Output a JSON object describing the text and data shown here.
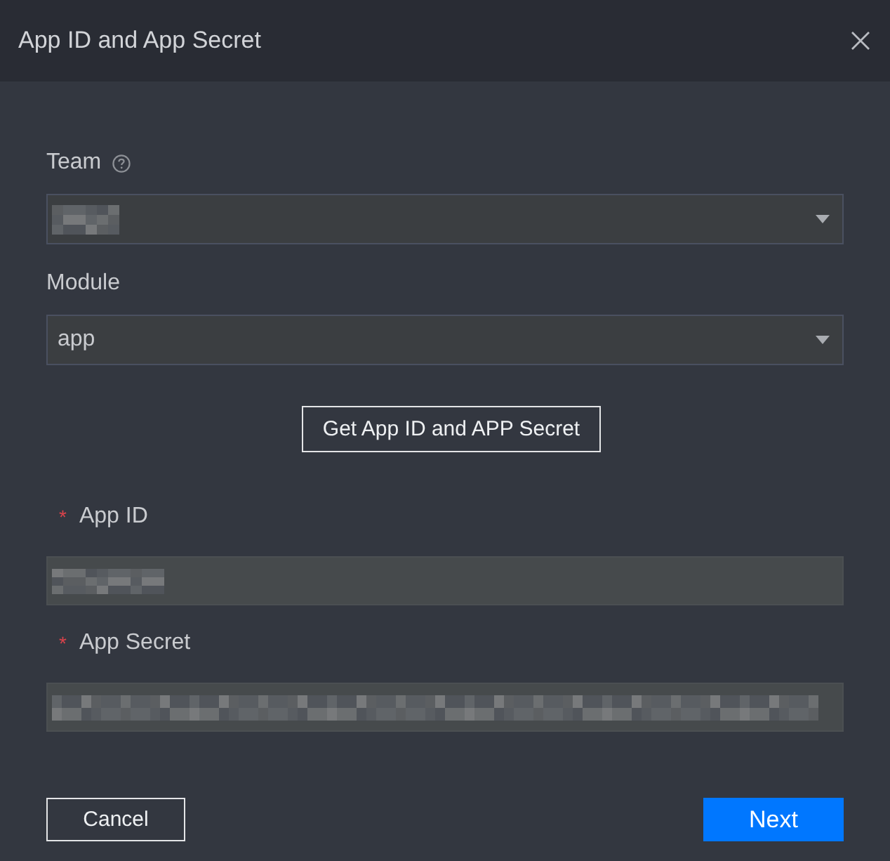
{
  "dialog": {
    "title": "App ID and App Secret"
  },
  "form": {
    "fields": [
      {
        "kind": "select",
        "label": "Team",
        "help": true,
        "redacted": true
      },
      {
        "kind": "select",
        "label": "Module",
        "help": false,
        "value": "app"
      },
      {
        "kind": "action",
        "button": "Get App ID and APP Secret"
      },
      {
        "kind": "input",
        "label": "App ID",
        "required_mark": "*",
        "redacted": true
      },
      {
        "kind": "input",
        "label": "App Secret",
        "required_mark": "*",
        "redacted": true
      }
    ]
  },
  "footer": {
    "buttons": [
      {
        "label": "Cancel",
        "kind": "secondary"
      },
      {
        "label": "Next",
        "kind": "primary"
      }
    ]
  }
}
